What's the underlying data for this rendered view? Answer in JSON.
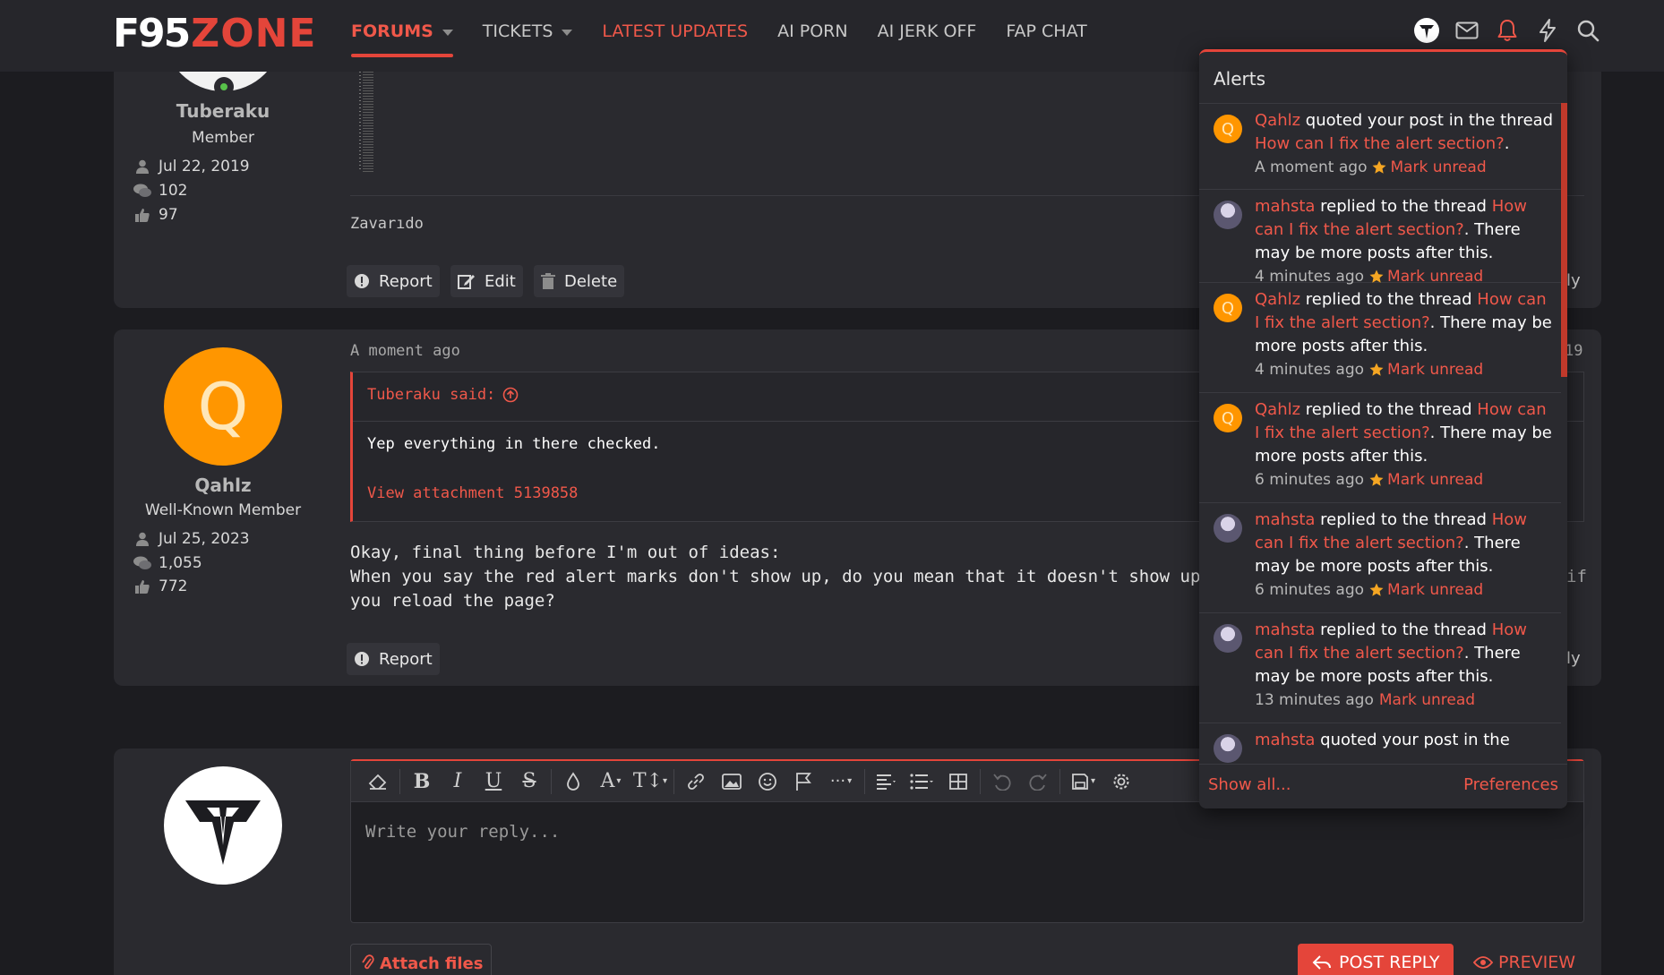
{
  "header": {
    "logo_left": "F95",
    "logo_right": "ZONE",
    "nav": [
      {
        "label": "FORUMS"
      },
      {
        "label": "TICKETS"
      },
      {
        "label": "LATEST UPDATES"
      },
      {
        "label": "AI PORN"
      },
      {
        "label": "AI JERK OFF"
      },
      {
        "label": "FAP CHAT"
      }
    ],
    "icons": [
      "user-avatar-icon",
      "envelope-icon",
      "bell-icon",
      "bolt-icon",
      "search-icon"
    ]
  },
  "post1": {
    "username": "Tuberaku",
    "user_title": "Member",
    "joined": "Jul 22, 2019",
    "messages": "102",
    "reactions": "97",
    "signature": "Zavarıdo",
    "actions": {
      "report": "Report",
      "edit": "Edit",
      "delete": "Delete"
    },
    "reply_partial": "ly"
  },
  "post2": {
    "avatar_letter": "Q",
    "username": "Qahlz",
    "user_title": "Well-Known Member",
    "joined": "Jul 25, 2023",
    "messages": "1,055",
    "reactions": "772",
    "time": "A moment ago",
    "post_number_partial": "19",
    "quote_author": "Tuberaku said:",
    "quote_text": "Yep everything in there checked.",
    "quote_attachment": "View attachment 5139858",
    "body_line1": "Okay, final thing before I'm out of ideas:",
    "body_line2": "When you say the red alert marks don't show up, do you mean that it doesn't show up while the p",
    "body_line2_partial_right": "if",
    "body_line3": "you reload the page?",
    "actions": {
      "report": "Report"
    },
    "reply_partial": "ly"
  },
  "reply": {
    "placeholder": "Write your reply...",
    "attach_label": "Attach files",
    "post_reply_label": "POST REPLY",
    "preview_label": "PREVIEW",
    "toolbar": [
      "eraser-icon",
      "bold-icon",
      "italic-icon",
      "underline-icon",
      "strike-icon",
      "color-icon",
      "font-size-icon",
      "text-size-icon",
      "link-icon",
      "image-icon",
      "smilie-icon",
      "flag-icon",
      "more-icon",
      "align-icon",
      "list-icon",
      "table-icon",
      "undo-icon",
      "redo-icon",
      "save-icon",
      "settings-icon"
    ]
  },
  "alerts": {
    "title": "Alerts",
    "items": [
      {
        "user": "Qahlz",
        "action": " quoted your post in the thread ",
        "thread": "How can I fix the alert section?",
        "suffix": ".",
        "time": "A moment ago",
        "mark": "Mark unread",
        "star": true
      },
      {
        "user": "mahsta",
        "action": " replied to the thread ",
        "thread": "How can I fix the alert section?",
        "suffix": ". There may be more posts after this.",
        "time": "4 minutes ago",
        "mark": "Mark unread",
        "star": true
      },
      {
        "user": "Qahlz",
        "action": " replied to the thread ",
        "thread": "How can I fix the alert section?",
        "suffix": ". There may be more posts after this.",
        "time": "4 minutes ago",
        "mark": "Mark unread",
        "star": true
      },
      {
        "user": "Qahlz",
        "action": " replied to the thread ",
        "thread": "How can I fix the alert section?",
        "suffix": ". There may be more posts after this.",
        "time": "6 minutes ago",
        "mark": "Mark unread",
        "star": true
      },
      {
        "user": "mahsta",
        "action": " replied to the thread ",
        "thread": "How can I fix the alert section?",
        "suffix": ". There may be more posts after this.",
        "time": "6 minutes ago",
        "mark": "Mark unread",
        "star": true
      },
      {
        "user": "mahsta",
        "action": " replied to the thread ",
        "thread": "How can I fix the alert section?",
        "suffix": ". There may be more posts after this.",
        "time": "13 minutes ago",
        "mark": "Mark unread",
        "star": false
      },
      {
        "user": "mahsta",
        "action": " quoted your post in the",
        "thread": "",
        "suffix": "",
        "time": "",
        "mark": "",
        "star": false
      }
    ],
    "show_all": "Show all...",
    "preferences": "Preferences"
  },
  "colors": {
    "accent": "#e4453a",
    "link": "#f0584a",
    "qahlz_avatar": "#ff9600",
    "star": "#f5a623"
  }
}
